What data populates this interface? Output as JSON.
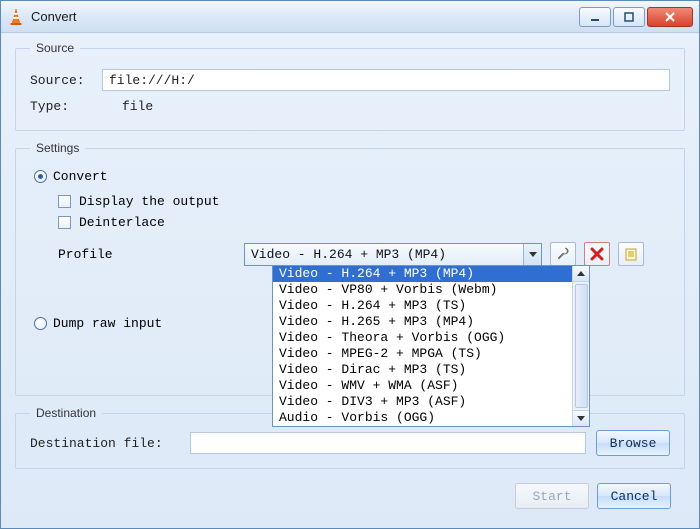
{
  "window": {
    "title": "Convert"
  },
  "source": {
    "legend": "Source",
    "label_source": "Source:",
    "source_value": "file:///H:/",
    "label_type": "Type:",
    "type_value": "file"
  },
  "settings": {
    "legend": "Settings",
    "convert_label": "Convert",
    "display_output_label": "Display the output",
    "deinterlace_label": "Deinterlace",
    "profile_label": "Profile",
    "profile_selected": "Video - H.264 + MP3 (MP4)",
    "profile_options": [
      "Video - H.264 + MP3 (MP4)",
      "Video - VP80 + Vorbis (Webm)",
      "Video - H.264 + MP3 (TS)",
      "Video - H.265 + MP3 (MP4)",
      "Video - Theora + Vorbis (OGG)",
      "Video - MPEG-2 + MPGA (TS)",
      "Video - Dirac + MP3 (TS)",
      "Video - WMV + WMA (ASF)",
      "Video - DIV3 + MP3 (ASF)",
      "Audio - Vorbis (OGG)"
    ],
    "dump_raw_label": "Dump raw input"
  },
  "destination": {
    "legend": "Destination",
    "label": "Destination file:",
    "value": "",
    "browse_label": "Browse"
  },
  "footer": {
    "start_label": "Start",
    "cancel_label": "Cancel"
  }
}
